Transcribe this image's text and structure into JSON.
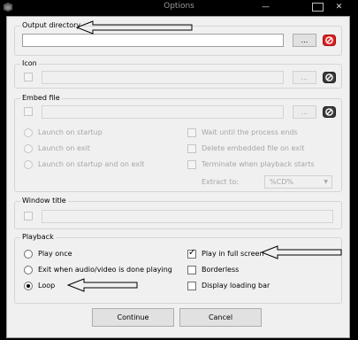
{
  "window": {
    "title": "Options",
    "minimize_glyph": "—",
    "maximize_glyph": "",
    "close_glyph": "✕"
  },
  "output_directory": {
    "title": "Output directory",
    "value": "",
    "browse_label": "...",
    "clear_icon": "no-entry-icon",
    "clear_color": "#e02020"
  },
  "icon": {
    "title": "Icon",
    "enabled": false,
    "value": "",
    "browse_label": "...",
    "clear_icon": "no-entry-icon"
  },
  "embed_file": {
    "title": "Embed file",
    "enabled": false,
    "value": "",
    "browse_label": "...",
    "clear_icon": "no-entry-icon",
    "launch_options": [
      "Launch on startup",
      "Launch on exit",
      "Launch on startup and on exit"
    ],
    "check_options": [
      "Wait until the process ends",
      "Delete embedded file on exit",
      "Terminate when playback starts"
    ],
    "extract_to_label": "Extract to:",
    "extract_to_value": "%CD%"
  },
  "window_title": {
    "title": "Window title",
    "enabled": false,
    "value": ""
  },
  "playback": {
    "title": "Playback",
    "radio_options": [
      "Play once",
      "Exit when audio/video is done playing",
      "Loop"
    ],
    "selected_radio": "Loop",
    "check_options": [
      "Play in full screen",
      "Borderless",
      "Display loading bar"
    ],
    "checked": [
      "Play in full screen"
    ]
  },
  "footer": {
    "continue_label": "Continue",
    "cancel_label": "Cancel"
  }
}
